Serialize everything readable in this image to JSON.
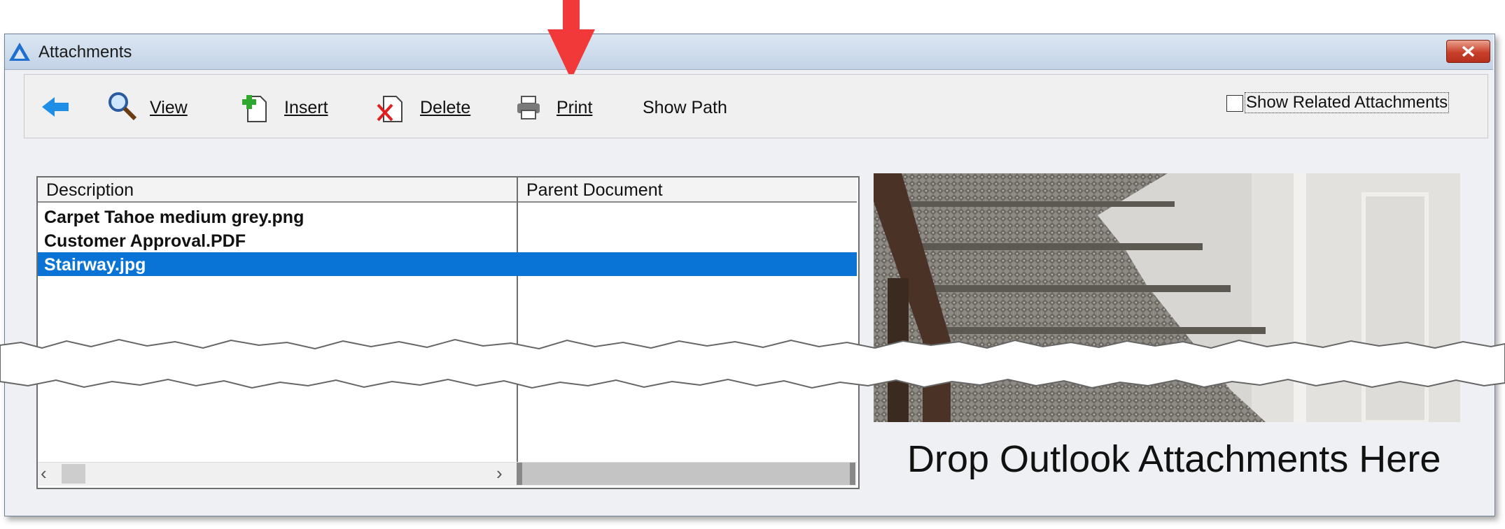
{
  "window": {
    "title": "Attachments",
    "close_label": "✕"
  },
  "toolbar": {
    "back_label": "",
    "view_label": "View",
    "insert_label": "Insert",
    "delete_label": "Delete",
    "print_label": "Print",
    "show_path_label": "Show Path",
    "show_related_label": "Show Related Attachments",
    "show_related_checked": false
  },
  "table": {
    "columns": [
      "Description",
      "Parent Document"
    ],
    "rows": [
      {
        "description": "Carpet Tahoe medium grey.png",
        "parent": "",
        "selected": false
      },
      {
        "description": "Customer Approval.PDF",
        "parent": "",
        "selected": false
      },
      {
        "description": "Stairway.jpg",
        "parent": "",
        "selected": true
      }
    ],
    "scroll_left": "‹",
    "scroll_right": "›"
  },
  "preview": {
    "drop_hint": "Drop Outlook Attachments Here"
  },
  "colors": {
    "selection": "#0a74d6",
    "annotation_arrow": "#f2393a",
    "back_arrow": "#1e8ee6"
  },
  "icons": {
    "back": "arrow-left-icon",
    "view": "magnifier-icon",
    "insert": "add-document-icon",
    "delete": "delete-document-icon",
    "print": "printer-icon"
  }
}
